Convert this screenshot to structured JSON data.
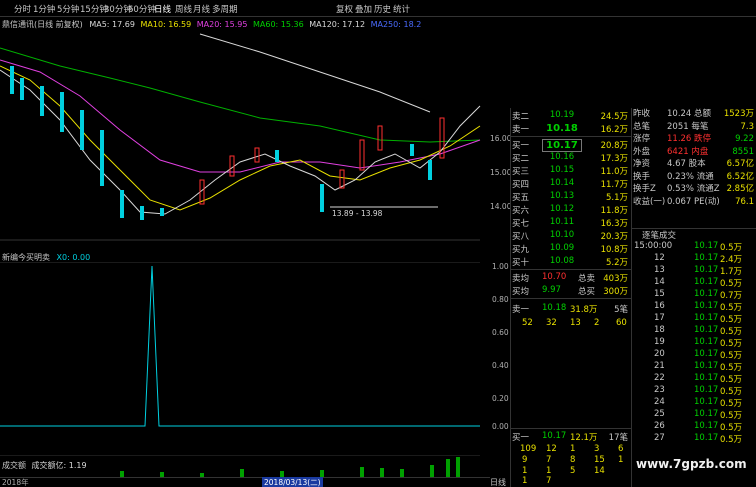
{
  "toolbar": {
    "periods": [
      "分时",
      "1分钟",
      "5分钟",
      "15分钟",
      "30分钟",
      "60分钟",
      "日线",
      "周线",
      "月线",
      "多周期"
    ],
    "right": [
      "复权",
      "叠加",
      "历史",
      "统计"
    ]
  },
  "ma_header": {
    "name": "鼎信通讯(日线 前复权)",
    "ma5": "MA5: 17.69",
    "ma10": "MA10: 16.59",
    "ma20": "MA20: 15.95",
    "ma60": "MA60: 15.36",
    "ma120": "MA120: 17.12",
    "ma250": "MA250: 18.2"
  },
  "price_axis": [
    "16.00",
    "15.00",
    "14.00"
  ],
  "range_label": "13.89 - 13.98",
  "indicator_header": {
    "name": "新编今买明卖",
    "value": "X0: 0.00"
  },
  "indicator_axis": [
    "1.00",
    "0.80",
    "0.60",
    "0.40",
    "0.20",
    "0.00"
  ],
  "volume_header": {
    "name": "成交额",
    "value": "成交额亿: 1.19"
  },
  "bottom_axis": {
    "left": "2018年",
    "date": "2018/03/13(二)",
    "period": "日线"
  },
  "quote_top": {
    "labels": [
      "昨收",
      "总笔",
      "涨停",
      "外盘",
      "净资",
      "换手",
      "换手Z",
      "收益(一)"
    ],
    "values": [
      "10.24 总额",
      "2051 每笔",
      "11.26 跌停",
      "6421 内盘",
      "4.67 股本",
      "0.23% 流通",
      "0.53% 流通Z",
      "0.067 PE(动)"
    ],
    "right": [
      "1523万",
      "7.3",
      "9.22",
      "8551",
      "6.57亿",
      "6.52亿",
      "2.85亿",
      "76.1"
    ]
  },
  "order_book": [
    {
      "n": "卖二",
      "p": "10.19",
      "v": "24.5万"
    },
    {
      "n": "卖一",
      "p": "10.18",
      "v": "16.2万"
    },
    {
      "n": "买一",
      "p": "10.17",
      "v": "20.8万"
    },
    {
      "n": "买二",
      "p": "10.16",
      "v": "17.3万"
    },
    {
      "n": "买三",
      "p": "10.15",
      "v": "11.0万"
    },
    {
      "n": "买四",
      "p": "10.14",
      "v": "11.7万"
    },
    {
      "n": "买五",
      "p": "10.13",
      "v": "5.1万"
    },
    {
      "n": "买六",
      "p": "10.12",
      "v": "11.8万"
    },
    {
      "n": "买七",
      "p": "10.11",
      "v": "16.3万"
    },
    {
      "n": "买八",
      "p": "10.10",
      "v": "20.3万"
    },
    {
      "n": "买九",
      "p": "10.09",
      "v": "10.8万"
    },
    {
      "n": "买十",
      "p": "10.08",
      "v": "5.2万"
    }
  ],
  "summary": [
    {
      "n": "卖均",
      "p": "10.70",
      "k": "总卖",
      "v": "403万"
    },
    {
      "n": "买均",
      "p": "9.97",
      "k": "总买",
      "v": "300万"
    }
  ],
  "sell_queue": {
    "n": "卖一",
    "p": "10.18",
    "q": "31.8万",
    "c": "5笔",
    "items": [
      "52",
      "32",
      "13",
      "2",
      "60"
    ]
  },
  "buy_queue": {
    "n": "买一",
    "p": "10.17",
    "q": "12.1万",
    "c": "17笔",
    "rows": [
      [
        "109",
        "12",
        "1",
        "3",
        "6"
      ],
      [
        "9",
        "7",
        "8",
        "15",
        "1"
      ],
      [
        "1",
        "1",
        "5",
        "14",
        ""
      ],
      [
        "1",
        "7",
        "",
        "",
        ""
      ]
    ]
  },
  "trades": {
    "title": "逐笔成交",
    "rows": [
      {
        "t": "15:00:00",
        "p": "10.17",
        "v": "0.5万"
      },
      {
        "t": "12",
        "p": "10.17",
        "v": "2.4万"
      },
      {
        "t": "13",
        "p": "10.17",
        "v": "1.7万"
      },
      {
        "t": "14",
        "p": "10.17",
        "v": "0.5万"
      },
      {
        "t": "15",
        "p": "10.17",
        "v": "0.7万"
      },
      {
        "t": "16",
        "p": "10.17",
        "v": "0.5万"
      },
      {
        "t": "17",
        "p": "10.17",
        "v": "0.5万"
      },
      {
        "t": "18",
        "p": "10.17",
        "v": "0.5万"
      },
      {
        "t": "19",
        "p": "10.17",
        "v": "0.5万"
      },
      {
        "t": "20",
        "p": "10.17",
        "v": "0.5万"
      },
      {
        "t": "21",
        "p": "10.17",
        "v": "0.5万"
      },
      {
        "t": "22",
        "p": "10.17",
        "v": "0.5万"
      },
      {
        "t": "23",
        "p": "10.17",
        "v": "0.5万"
      },
      {
        "t": "24",
        "p": "10.17",
        "v": "0.5万"
      },
      {
        "t": "25",
        "p": "10.17",
        "v": "0.5万"
      },
      {
        "t": "26",
        "p": "10.17",
        "v": "0.5万"
      },
      {
        "t": "27",
        "p": "10.17",
        "v": "0.5万"
      }
    ]
  },
  "watermark": "www.7gpzb.com"
}
